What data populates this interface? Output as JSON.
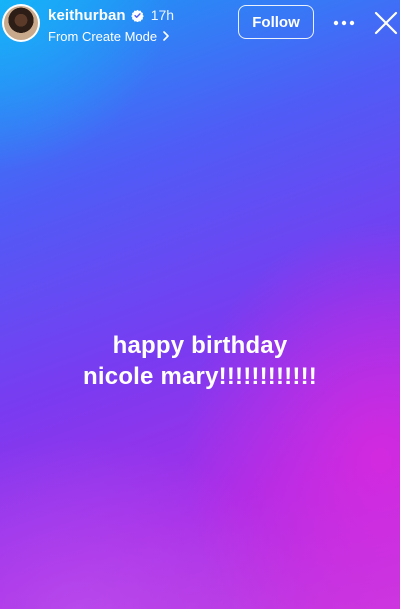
{
  "header": {
    "username": "keithurban",
    "time_ago": "17h",
    "mode_label": "From Create Mode",
    "follow_label": "Follow",
    "avatar_icon": "profile-photo",
    "verified_icon": "verified-badge-icon",
    "more_icon": "more-horizontal-icon",
    "close_icon": "close-icon"
  },
  "story": {
    "caption_line1": "happy birthday",
    "caption_line2": "nicole mary!!!!!!!!!!!!",
    "background_colors": [
      "#1a9bf5",
      "#4f5cf6",
      "#7a3bf0",
      "#a72ee8",
      "#c63be0"
    ]
  }
}
